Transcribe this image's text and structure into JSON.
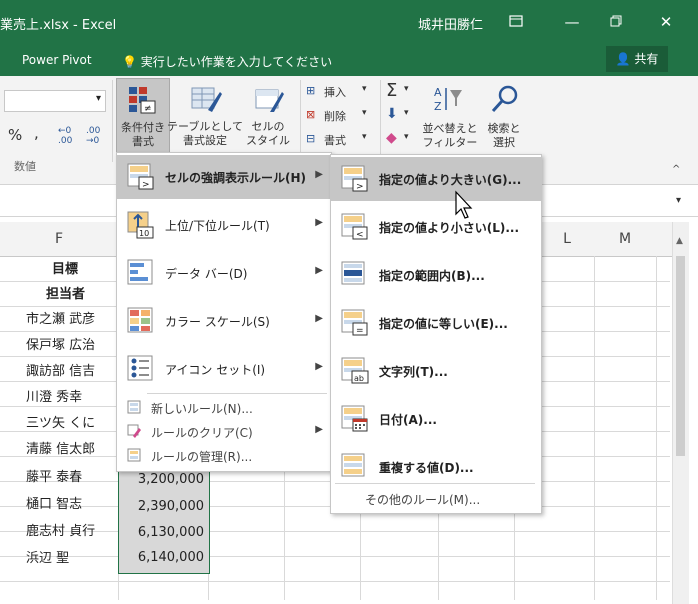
{
  "window": {
    "title": "業売上.xlsx  -  Excel",
    "user": "城井田勝仁",
    "controls": [
      "restore-ribbon",
      "minimize",
      "maximize",
      "close"
    ]
  },
  "tabs": {
    "power_pivot": "Power Pivot",
    "tell_me": "実行したい作業を入力してください",
    "share": "共有"
  },
  "ribbon": {
    "number_format": {
      "percent": "%",
      "comma": ",",
      "inc_decimal": "←0 .00",
      "dec_decimal": ".00 →0",
      "group_label": "数値"
    },
    "cond_format": {
      "line1": "条件付き",
      "line2": "書式"
    },
    "format_table": {
      "line1": "テーブルとして",
      "line2": "書式設定"
    },
    "cell_styles": {
      "line1": "セルの",
      "line2": "スタイル"
    },
    "cells": {
      "insert": "挿入",
      "delete": "削除",
      "format": "書式"
    },
    "editing": {
      "sort_line1": "並べ替えと",
      "sort_line2": "フィルター",
      "find_line1": "検索と",
      "find_line2": "選択"
    }
  },
  "columns": {
    "f": "F",
    "l": "L",
    "m": "M"
  },
  "sheet": {
    "rows": [
      {
        "name": "目標",
        "value": ""
      },
      {
        "name": "担当者",
        "value": ""
      },
      {
        "name": "市之瀬 武彦",
        "value": ""
      },
      {
        "name": "保戸塚 広治",
        "value": ""
      },
      {
        "name": "諏訪部 信吉",
        "value": ""
      },
      {
        "name": "川澄 秀幸",
        "value": ""
      },
      {
        "name": "三ツ矢 くに",
        "value": ""
      },
      {
        "name": "清藤 信太郎",
        "value": ""
      },
      {
        "name": "藤平 泰春",
        "value": "3,200,000"
      },
      {
        "name": "樋口 智志",
        "value": "2,390,000"
      },
      {
        "name": "鹿志村 貞行",
        "value": "6,130,000"
      },
      {
        "name": "浜辺 聖",
        "value": "6,140,000"
      }
    ]
  },
  "menu": {
    "items": [
      {
        "label": "セルの強調表示ルール(H)",
        "highlighted": true,
        "icon": "highlight-cells-icon"
      },
      {
        "label": "上位/下位ルール(T)",
        "icon": "top-bottom-icon"
      },
      {
        "label": "データ バー(D)",
        "icon": "data-bars-icon"
      },
      {
        "label": "カラー スケール(S)",
        "icon": "color-scales-icon"
      },
      {
        "label": "アイコン セット(I)",
        "icon": "icon-sets-icon"
      }
    ],
    "small_items": [
      {
        "label": "新しいルール(N)...",
        "icon": "new-rule-icon"
      },
      {
        "label": "ルールのクリア(C)",
        "icon": "clear-rules-icon"
      },
      {
        "label": "ルールの管理(R)...",
        "icon": "manage-rules-icon"
      }
    ]
  },
  "submenu": {
    "items": [
      {
        "label": "指定の値より大きい(G)...",
        "highlighted": true,
        "icon": "greater-than-icon"
      },
      {
        "label": "指定の値より小さい(L)...",
        "icon": "less-than-icon"
      },
      {
        "label": "指定の範囲内(B)...",
        "icon": "between-icon"
      },
      {
        "label": "指定の値に等しい(E)...",
        "icon": "equal-to-icon"
      },
      {
        "label": "文字列(T)...",
        "icon": "text-contains-icon"
      },
      {
        "label": "日付(A)...",
        "icon": "date-occurring-icon"
      },
      {
        "label": "重複する値(D)...",
        "icon": "duplicate-values-icon"
      }
    ],
    "more": "その他のルール(M)..."
  },
  "colors": {
    "accent": "#217346",
    "menu_hover": "#c6c6c6",
    "ribbon_bg": "#f3f3f3"
  }
}
